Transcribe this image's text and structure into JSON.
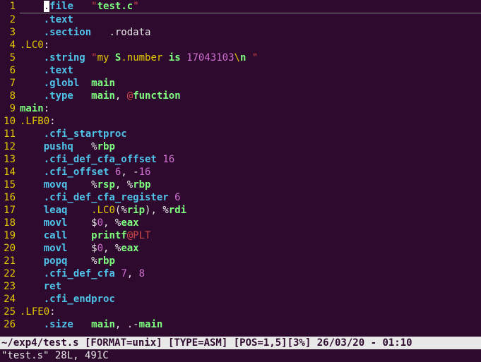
{
  "gutter": [
    "1",
    "2",
    "3",
    "4",
    "5",
    "6",
    "7",
    "8",
    "9",
    "10",
    "11",
    "12",
    "13",
    "14",
    "15",
    "16",
    "17",
    "18",
    "19",
    "20",
    "21",
    "22",
    "23",
    "24",
    "25",
    "26"
  ],
  "lines": {
    "l1": {
      "indent": "    ",
      "cursor": ".",
      "dir": "file",
      "gap": "   ",
      "q1": "\"",
      "s1": "test.c",
      "q2": "\""
    },
    "l2": {
      "indent": "    ",
      "dir": ".text"
    },
    "l3": {
      "indent": "    ",
      "dir": ".section",
      "gap": "   ",
      "arg": ".rodata"
    },
    "l4": {
      "label": ".LC0",
      "colon": ":"
    },
    "l5": {
      "indent": "    ",
      "dir": ".string",
      "sp": " ",
      "q1": "\"",
      "sa": "my ",
      "sb": "S",
      "sc": ".number ",
      "sd": "is",
      "se": " ",
      "sf": "17043103",
      "sg": "\\",
      "sh": "n",
      "si": " ",
      "q2": "\""
    },
    "l6": {
      "indent": "    ",
      "dir": ".text"
    },
    "l7": {
      "indent": "    ",
      "dir": ".globl",
      "gap": "  ",
      "sym": "main"
    },
    "l8": {
      "indent": "    ",
      "dir": ".type",
      "gap": "   ",
      "sym": "main",
      "comma": ", ",
      "at": "@",
      "fn": "function"
    },
    "l9": {
      "label": "main",
      "colon": ":"
    },
    "l10": {
      "label": ".LFB0",
      "colon": ":"
    },
    "l11": {
      "indent": "    ",
      "dir": ".cfi_startproc"
    },
    "l12": {
      "indent": "    ",
      "op": "pushq",
      "gap": "   ",
      "pct": "%",
      "reg": "rbp"
    },
    "l13": {
      "indent": "    ",
      "dir": ".cfi_def_cfa_offset",
      "sp": " ",
      "n1": "16"
    },
    "l14": {
      "indent": "    ",
      "dir": ".cfi_offset",
      "sp": " ",
      "n1": "6",
      "comma": ", -",
      "n2": "16"
    },
    "l15": {
      "indent": "    ",
      "op": "movq",
      "gap": "    ",
      "p1": "%",
      "r1": "rsp",
      "comma": ", ",
      "p2": "%",
      "r2": "rbp"
    },
    "l16": {
      "indent": "    ",
      "dir": ".cfi_def_cfa_register",
      "sp": " ",
      "n1": "6"
    },
    "l17": {
      "indent": "    ",
      "op": "leaq",
      "gap": "    ",
      "lbl": ".LC0",
      "lp": "(",
      "p1": "%",
      "r1": "rip",
      "rp": ")",
      "comma": ", ",
      "p2": "%",
      "r2": "rdi"
    },
    "l18": {
      "indent": "    ",
      "op": "movl",
      "gap": "    ",
      "d": "$",
      "n": "0",
      "comma": ", ",
      "p": "%",
      "r": "eax"
    },
    "l19": {
      "indent": "    ",
      "op": "call",
      "gap": "    ",
      "sym": "printf",
      "at": "@PLT"
    },
    "l20": {
      "indent": "    ",
      "op": "movl",
      "gap": "    ",
      "d": "$",
      "n": "0",
      "comma": ", ",
      "p": "%",
      "r": "eax"
    },
    "l21": {
      "indent": "    ",
      "op": "popq",
      "gap": "    ",
      "p": "%",
      "r": "rbp"
    },
    "l22": {
      "indent": "    ",
      "dir": ".cfi_def_cfa",
      "sp": " ",
      "n1": "7",
      "comma": ", ",
      "n2": "8"
    },
    "l23": {
      "indent": "    ",
      "op": "ret"
    },
    "l24": {
      "indent": "    ",
      "dir": ".cfi_endproc"
    },
    "l25": {
      "label": ".LFE0",
      "colon": ":"
    },
    "l26": {
      "indent": "    ",
      "dir": ".size",
      "gap": "   ",
      "sym": "main",
      "comma": ", .-",
      "sym2": "main"
    }
  },
  "status": "~/exp4/test.s [FORMAT=unix] [TYPE=ASM] [POS=1,5][3%] 26/03/20 - 01:10",
  "cmdline": "\"test.s\" 28L, 491C"
}
